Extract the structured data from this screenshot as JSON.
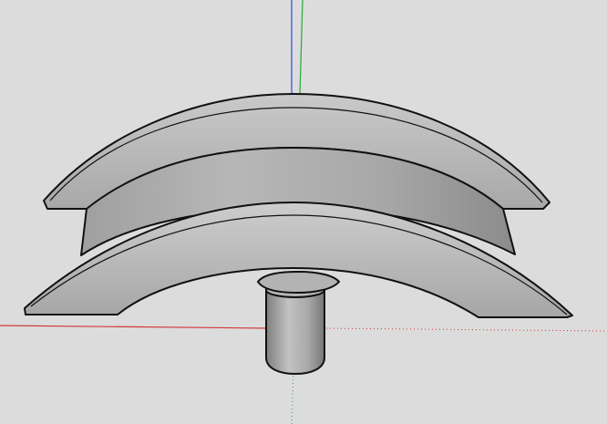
{
  "viewport": {
    "background_color": "#dcdcdc"
  },
  "axes": {
    "red_color": "#d23a3a",
    "green_color": "#27a83d",
    "blue_color": "#2b4fd8"
  },
  "model": {
    "outline_color": "#111111",
    "light_face_color": "#bdbdbd",
    "mid_face_color": "#a9a9a9",
    "dark_face_color": "#8d8d8d"
  }
}
